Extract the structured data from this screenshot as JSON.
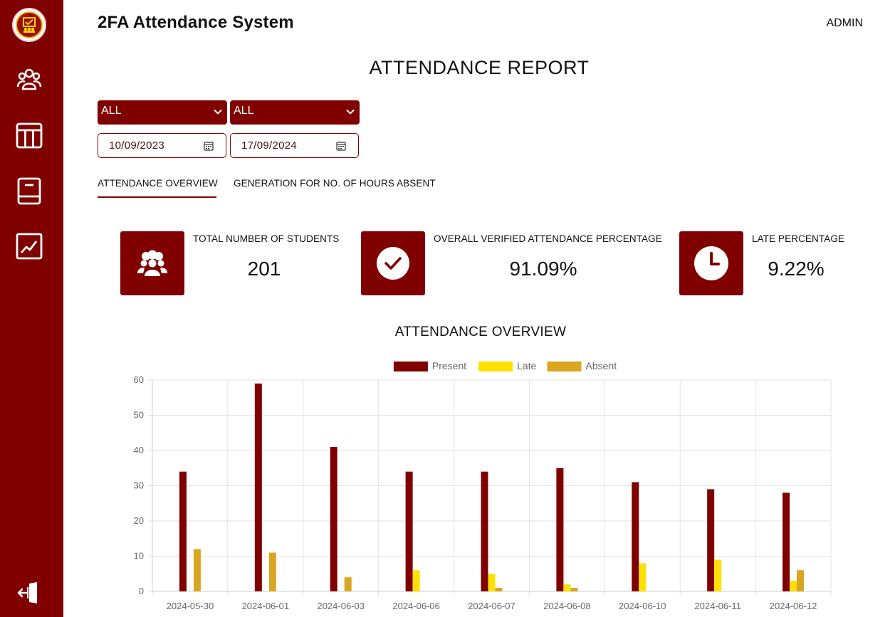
{
  "app": {
    "title": "2FA Attendance System",
    "user": "ADMIN"
  },
  "sidebar": {
    "items": [
      {
        "icon": "users-icon"
      },
      {
        "icon": "table-icon"
      },
      {
        "icon": "book-icon"
      },
      {
        "icon": "chart-line-icon"
      }
    ],
    "logout_icon": "logout-icon"
  },
  "page": {
    "title": "ATTENDANCE REPORT"
  },
  "filters": {
    "select1": "ALL",
    "select2": "ALL",
    "date_from": "10/09/2023",
    "date_to": "17/09/2024"
  },
  "tabs": [
    {
      "label": "ATTENDANCE OVERVIEW",
      "active": true
    },
    {
      "label": "GENERATION FOR NO. OF HOURS ABSENT",
      "active": false
    }
  ],
  "stats": [
    {
      "label": "TOTAL NUMBER OF STUDENTS",
      "value": "201",
      "icon": "users-icon"
    },
    {
      "label": "OVERALL VERIFIED ATTENDANCE PERCENTAGE",
      "value": "91.09%",
      "icon": "check-circle-icon"
    },
    {
      "label": "LATE PERCENTAGE",
      "value": "9.22%",
      "icon": "clock-icon"
    }
  ],
  "colors": {
    "primary": "#800000",
    "present": "#800000",
    "late": "#ffe000",
    "absent": "#daa520"
  },
  "chart_title": "ATTENDANCE OVERVIEW",
  "chart_data": {
    "type": "bar",
    "title": "ATTENDANCE OVERVIEW",
    "categories": [
      "2024-05-30",
      "2024-06-01",
      "2024-06-03",
      "2024-06-06",
      "2024-06-07",
      "2024-06-08",
      "2024-06-10",
      "2024-06-11",
      "2024-06-12"
    ],
    "series": [
      {
        "name": "Present",
        "color": "#800000",
        "values": [
          34,
          59,
          41,
          34,
          34,
          35,
          31,
          29,
          28
        ]
      },
      {
        "name": "Late",
        "color": "#ffe000",
        "values": [
          0,
          0,
          0,
          6,
          5,
          2,
          8,
          9,
          3
        ]
      },
      {
        "name": "Absent",
        "color": "#daa520",
        "values": [
          12,
          11,
          4,
          0,
          1,
          1,
          0,
          0,
          6
        ]
      }
    ],
    "ylim": [
      0,
      60
    ],
    "yticks": [
      0,
      10,
      20,
      30,
      40,
      50,
      60
    ],
    "grid": true,
    "legend": "top-center"
  }
}
